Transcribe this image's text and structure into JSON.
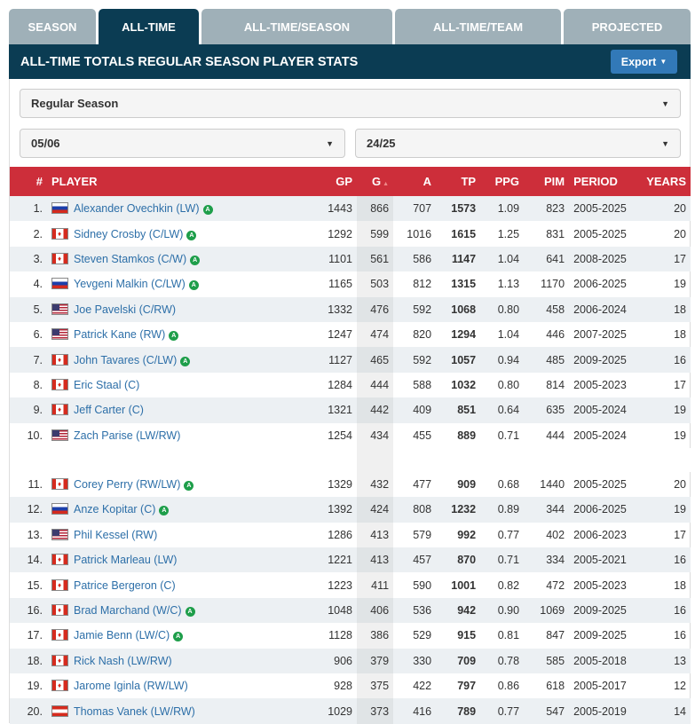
{
  "tabs": [
    "SEASON",
    "ALL-TIME",
    "ALL-TIME/SEASON",
    "ALL-TIME/TEAM",
    "PROJECTED"
  ],
  "title": "ALL-TIME TOTALS REGULAR SEASON PLAYER STATS",
  "export_label": "Export",
  "filters": {
    "season_type": "Regular Season",
    "from": "05/06",
    "to": "24/25"
  },
  "columns": [
    "#",
    "PLAYER",
    "GP",
    "G",
    "A",
    "TP",
    "PPG",
    "PIM",
    "PERIOD",
    "YEARS"
  ],
  "colors": {
    "header": "#0b3c53",
    "table_header": "#cd2e3a",
    "link": "#2d6fa8",
    "active_badge": "#1e9e4a"
  },
  "badge_label": "A",
  "rows": [
    {
      "rank": "1.",
      "flag": "RUS",
      "name": "Alexander Ovechkin (LW)",
      "active": true,
      "gp": "1443",
      "g": "866",
      "a": "707",
      "tp": "1573",
      "ppg": "1.09",
      "pim": "823",
      "period": "2005-2025",
      "years": "20"
    },
    {
      "rank": "2.",
      "flag": "CAN",
      "name": "Sidney Crosby (C/LW)",
      "active": true,
      "gp": "1292",
      "g": "599",
      "a": "1016",
      "tp": "1615",
      "ppg": "1.25",
      "pim": "831",
      "period": "2005-2025",
      "years": "20"
    },
    {
      "rank": "3.",
      "flag": "CAN",
      "name": "Steven Stamkos (C/W)",
      "active": true,
      "gp": "1101",
      "g": "561",
      "a": "586",
      "tp": "1147",
      "ppg": "1.04",
      "pim": "641",
      "period": "2008-2025",
      "years": "17"
    },
    {
      "rank": "4.",
      "flag": "RUS",
      "name": "Yevgeni Malkin (C/LW)",
      "active": true,
      "gp": "1165",
      "g": "503",
      "a": "812",
      "tp": "1315",
      "ppg": "1.13",
      "pim": "1170",
      "period": "2006-2025",
      "years": "19"
    },
    {
      "rank": "5.",
      "flag": "USA",
      "name": "Joe Pavelski (C/RW)",
      "active": false,
      "gp": "1332",
      "g": "476",
      "a": "592",
      "tp": "1068",
      "ppg": "0.80",
      "pim": "458",
      "period": "2006-2024",
      "years": "18"
    },
    {
      "rank": "6.",
      "flag": "USA",
      "name": "Patrick Kane (RW)",
      "active": true,
      "gp": "1247",
      "g": "474",
      "a": "820",
      "tp": "1294",
      "ppg": "1.04",
      "pim": "446",
      "period": "2007-2025",
      "years": "18"
    },
    {
      "rank": "7.",
      "flag": "CAN",
      "name": "John Tavares (C/LW)",
      "active": true,
      "gp": "1127",
      "g": "465",
      "a": "592",
      "tp": "1057",
      "ppg": "0.94",
      "pim": "485",
      "period": "2009-2025",
      "years": "16"
    },
    {
      "rank": "8.",
      "flag": "CAN",
      "name": "Eric Staal (C)",
      "active": false,
      "gp": "1284",
      "g": "444",
      "a": "588",
      "tp": "1032",
      "ppg": "0.80",
      "pim": "814",
      "period": "2005-2023",
      "years": "17"
    },
    {
      "rank": "9.",
      "flag": "CAN",
      "name": "Jeff Carter (C)",
      "active": false,
      "gp": "1321",
      "g": "442",
      "a": "409",
      "tp": "851",
      "ppg": "0.64",
      "pim": "635",
      "period": "2005-2024",
      "years": "19"
    },
    {
      "rank": "10.",
      "flag": "USA",
      "name": "Zach Parise (LW/RW)",
      "active": false,
      "gp": "1254",
      "g": "434",
      "a": "455",
      "tp": "889",
      "ppg": "0.71",
      "pim": "444",
      "period": "2005-2024",
      "years": "19"
    },
    {
      "rank": "11.",
      "flag": "CAN",
      "name": "Corey Perry (RW/LW)",
      "active": true,
      "gp": "1329",
      "g": "432",
      "a": "477",
      "tp": "909",
      "ppg": "0.68",
      "pim": "1440",
      "period": "2005-2025",
      "years": "20"
    },
    {
      "rank": "12.",
      "flag": "SVN",
      "name": "Anze Kopitar (C)",
      "active": true,
      "gp": "1392",
      "g": "424",
      "a": "808",
      "tp": "1232",
      "ppg": "0.89",
      "pim": "344",
      "period": "2006-2025",
      "years": "19"
    },
    {
      "rank": "13.",
      "flag": "USA",
      "name": "Phil Kessel (RW)",
      "active": false,
      "gp": "1286",
      "g": "413",
      "a": "579",
      "tp": "992",
      "ppg": "0.77",
      "pim": "402",
      "period": "2006-2023",
      "years": "17"
    },
    {
      "rank": "14.",
      "flag": "CAN",
      "name": "Patrick Marleau (LW)",
      "active": false,
      "gp": "1221",
      "g": "413",
      "a": "457",
      "tp": "870",
      "ppg": "0.71",
      "pim": "334",
      "period": "2005-2021",
      "years": "16"
    },
    {
      "rank": "15.",
      "flag": "CAN",
      "name": "Patrice Bergeron (C)",
      "active": false,
      "gp": "1223",
      "g": "411",
      "a": "590",
      "tp": "1001",
      "ppg": "0.82",
      "pim": "472",
      "period": "2005-2023",
      "years": "18"
    },
    {
      "rank": "16.",
      "flag": "CAN",
      "name": "Brad Marchand (W/C)",
      "active": true,
      "gp": "1048",
      "g": "406",
      "a": "536",
      "tp": "942",
      "ppg": "0.90",
      "pim": "1069",
      "period": "2009-2025",
      "years": "16"
    },
    {
      "rank": "17.",
      "flag": "CAN",
      "name": "Jamie Benn (LW/C)",
      "active": true,
      "gp": "1128",
      "g": "386",
      "a": "529",
      "tp": "915",
      "ppg": "0.81",
      "pim": "847",
      "period": "2009-2025",
      "years": "16"
    },
    {
      "rank": "18.",
      "flag": "CAN",
      "name": "Rick Nash (LW/RW)",
      "active": false,
      "gp": "906",
      "g": "379",
      "a": "330",
      "tp": "709",
      "ppg": "0.78",
      "pim": "585",
      "period": "2005-2018",
      "years": "13"
    },
    {
      "rank": "19.",
      "flag": "CAN",
      "name": "Jarome Iginla (RW/LW)",
      "active": false,
      "gp": "928",
      "g": "375",
      "a": "422",
      "tp": "797",
      "ppg": "0.86",
      "pim": "618",
      "period": "2005-2017",
      "years": "12"
    },
    {
      "rank": "20.",
      "flag": "AUT",
      "name": "Thomas Vanek (LW/RW)",
      "active": false,
      "gp": "1029",
      "g": "373",
      "a": "416",
      "tp": "789",
      "ppg": "0.77",
      "pim": "547",
      "period": "2005-2019",
      "years": "14"
    }
  ]
}
